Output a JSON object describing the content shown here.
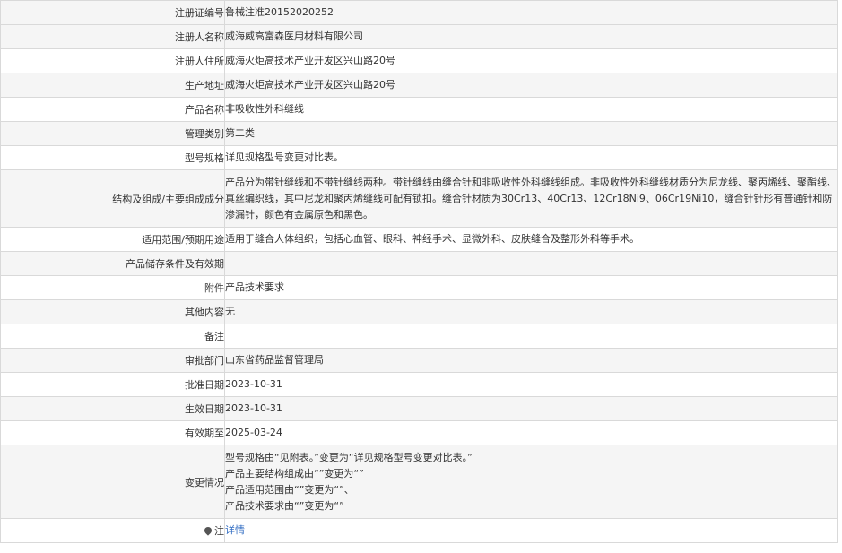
{
  "rows": [
    {
      "label": "注册证编号",
      "value": "鲁械注准20152020252"
    },
    {
      "label": "注册人名称",
      "value": "威海威高富森医用材料有限公司"
    },
    {
      "label": "注册人住所",
      "value": "威海火炬高技术产业开发区兴山路20号"
    },
    {
      "label": "生产地址",
      "value": "威海火炬高技术产业开发区兴山路20号"
    },
    {
      "label": "产品名称",
      "value": "非吸收性外科缝线"
    },
    {
      "label": "管理类别",
      "value": "第二类"
    },
    {
      "label": "型号规格",
      "value": "详见规格型号变更对比表。"
    },
    {
      "label": "结构及组成/主要组成成分",
      "value": "产品分为带针缝线和不带针缝线两种。带针缝线由缝合针和非吸收性外科缝线组成。非吸收性外科缝线材质分为尼龙线、聚丙烯线、聚酯线、真丝编织线，其中尼龙和聚丙烯缝线可配有锁扣。缝合针材质为30Cr13、40Cr13、12Cr18Ni9、06Cr19Ni10，缝合针针形有普通针和防渗漏针，颜色有金属原色和黑色。"
    },
    {
      "label": "适用范围/预期用途",
      "value": "适用于缝合人体组织，包括心血管、眼科、神经手术、显微外科、皮肤缝合及整形外科等手术。"
    },
    {
      "label": "产品储存条件及有效期",
      "value": ""
    },
    {
      "label": "附件",
      "value": "产品技术要求"
    },
    {
      "label": "其他内容",
      "value": "无"
    },
    {
      "label": "备注",
      "value": ""
    },
    {
      "label": "审批部门",
      "value": "山东省药品监督管理局"
    },
    {
      "label": "批准日期",
      "value": "2023-10-31"
    },
    {
      "label": "生效日期",
      "value": "2023-10-31"
    },
    {
      "label": "有效期至",
      "value": "2025-03-24"
    }
  ],
  "change": {
    "label": "变更情况",
    "lines": [
      "型号规格由“见附表。”变更为“详见规格型号变更对比表。”",
      "产品主要结构组成由“”变更为“”",
      "产品适用范围由“”变更为“”、",
      "产品技术要求由“”变更为“”"
    ]
  },
  "note": {
    "label": "注",
    "link_text": "详情",
    "icon": "map-pin-icon"
  }
}
